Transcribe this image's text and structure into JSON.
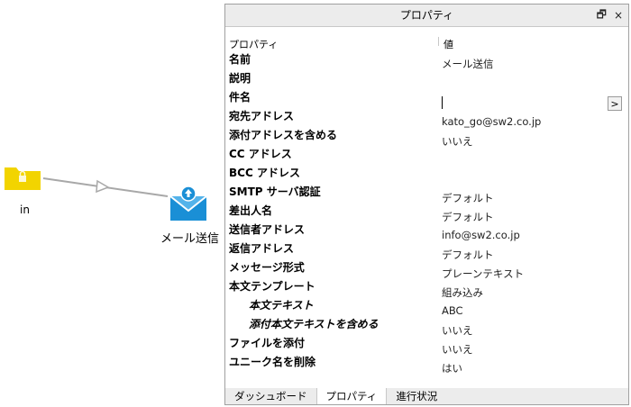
{
  "canvas": {
    "nodes": [
      {
        "label": "in"
      },
      {
        "label": "メール送信"
      }
    ]
  },
  "panel": {
    "title": "プロパティ",
    "pin_icon": "restore-icon",
    "close_label": "×",
    "header": {
      "property": "プロパティ",
      "value": "値"
    },
    "rows": [
      {
        "key": "名前",
        "value": "メール送信"
      },
      {
        "key": "説明",
        "value": ""
      },
      {
        "key": "件名",
        "value": ""
      },
      {
        "key": "宛先アドレス",
        "value": "kato_go@sw2.co.jp"
      },
      {
        "key": "添付アドレスを含める",
        "value": "いいえ"
      },
      {
        "key": "CC アドレス",
        "value": ""
      },
      {
        "key": "BCC アドレス",
        "value": ""
      },
      {
        "key": "SMTP サーバ認証",
        "value": "デフォルト"
      },
      {
        "key": "差出人名",
        "value": "デフォルト"
      },
      {
        "key": "送信者アドレス",
        "value": "info@sw2.co.jp"
      },
      {
        "key": "返信アドレス",
        "value": "デフォルト"
      },
      {
        "key": "メッセージ形式",
        "value": "プレーンテキスト"
      },
      {
        "key": "本文テンプレート",
        "value": "組み込み"
      },
      {
        "key": "本文テキスト",
        "value": "ABC"
      },
      {
        "key": "添付本文テキストを含める",
        "value": "いいえ"
      },
      {
        "key": "ファイルを添付",
        "value": "いいえ"
      },
      {
        "key": "ユニーク名を削除",
        "value": "はい"
      }
    ],
    "more_button": ">",
    "tabs": [
      "ダッシュボード",
      "プロパティ",
      "進行状況"
    ]
  }
}
